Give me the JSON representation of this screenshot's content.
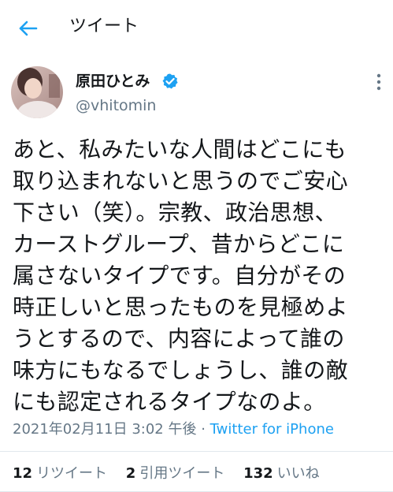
{
  "header": {
    "title": "ツイート",
    "back_icon": "arrow-left-icon"
  },
  "author": {
    "name": "原田ひとみ",
    "handle": "@vhitomin",
    "verified": true,
    "verified_icon": "verified-badge-icon"
  },
  "tweet": {
    "lines": [
      "あと、私みたいな人間はどこにも",
      "取り込まれないと思うのでご安心",
      "下さい（笑）。宗教、政治思想、",
      "カーストグループ、昔からどこに",
      "属さないタイプです。自分がその",
      "時正しいと思ったものを見極めよ",
      "うとするので、内容によって誰の",
      "味方にもなるでしょうし、誰の敵",
      "にも認定されるタイプなのよ。"
    ],
    "timestamp": "2021年02月11日 3:02 午後",
    "separator": " · ",
    "source": "Twitter for iPhone"
  },
  "stats": {
    "retweets": {
      "count": "12",
      "label": "リツイート"
    },
    "quotes": {
      "count": "2",
      "label": "引用ツイート"
    },
    "likes": {
      "count": "132",
      "label": "いいね"
    }
  },
  "colors": {
    "accent": "#1da1f2",
    "text": "#14171a",
    "secondary": "#657786",
    "divider": "#e1e8ed"
  }
}
